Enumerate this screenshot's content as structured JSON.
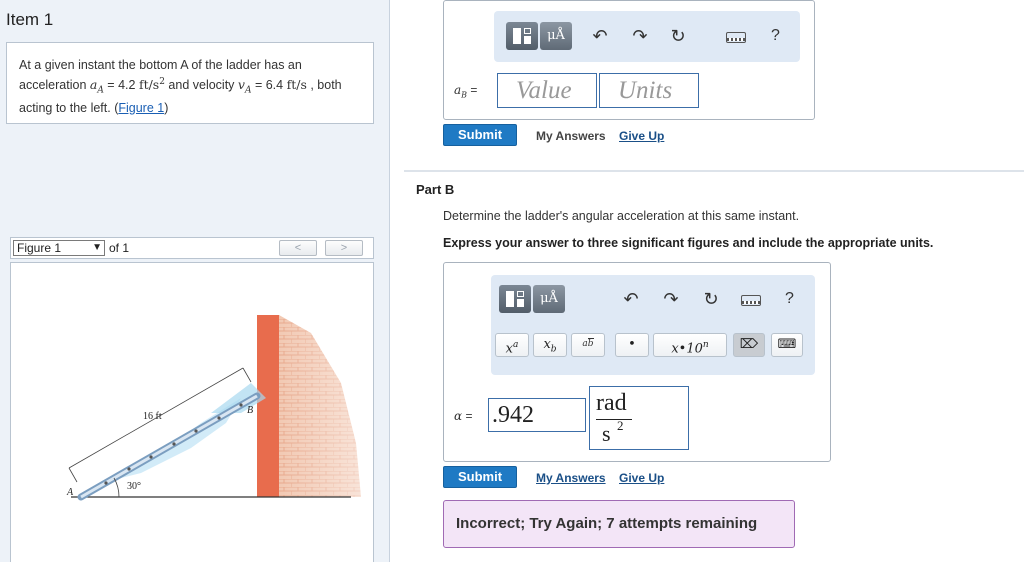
{
  "item_title": "Item 1",
  "problem": {
    "text_1": "At a given instant the bottom A of the ladder has an acceleration ",
    "a_sym": "a",
    "a_sub": "A",
    "a_val": " = 4.2 ",
    "a_unit": "ft/s",
    "a_unit_exp": "2",
    "text_2": " and velocity ",
    "v_sym": "v",
    "v_sub": "A",
    "v_val": " = 6.4 ",
    "v_unit": "ft/s",
    "text_3": " , both acting to the left. (",
    "fig_link": "Figure 1",
    "text_4": ")"
  },
  "figure_nav": {
    "select_value": "Figure 1",
    "of_text": "of 1",
    "prev": "<",
    "next": ">"
  },
  "figure": {
    "length_label": "16 ft",
    "angle_label": "30°",
    "point_a": "A",
    "point_b": "B"
  },
  "part_a": {
    "eq_sym": "a",
    "eq_sub": "B",
    "eq_tail": " =",
    "value_placeholder": "Value",
    "units_placeholder": "Units",
    "submit": "Submit",
    "my_answers": "My Answers",
    "give_up": "Give Up"
  },
  "toolbar": {
    "units_label": "μÅ",
    "help": "?"
  },
  "part_b": {
    "title": "Part B",
    "question": "Determine the ladder's angular acceleration at this same instant.",
    "instruction": "Express your answer to three significant figures and include the appropriate units.",
    "symbols": {
      "xa_base": "x",
      "xa_sup": "a",
      "xb_base": "x",
      "xb_sub": "b",
      "frac_top": "a",
      "frac_bottom": "b",
      "dot": "•",
      "sci": "x•10",
      "sci_exp": "n"
    },
    "eq_sym": "α",
    "eq_tail": " =",
    "answer_value": ".942",
    "unit_num": "rad",
    "unit_den": "s",
    "unit_exp": "2",
    "submit": "Submit",
    "my_answers": "My Answers",
    "give_up": "Give Up",
    "feedback": "Incorrect; Try Again; 7 attempts remaining"
  },
  "colors": {
    "submit": "#1f7ac4",
    "feedback_bg": "#f3e5f7",
    "feedback_border": "#a06ab4",
    "toolbar_bg": "#dfe9f5"
  }
}
